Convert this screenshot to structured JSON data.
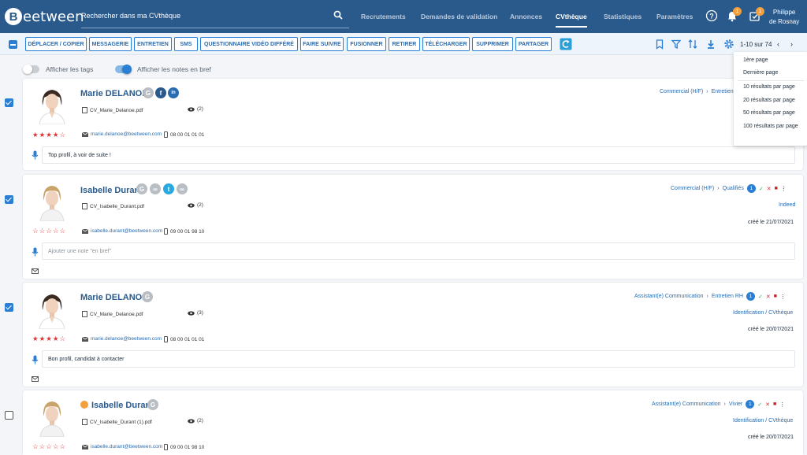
{
  "app": {
    "logo_letter": "B",
    "logo_text": "eetween",
    "brand_color": "#2a5a8c",
    "accent_color": "#2a7ed3"
  },
  "search": {
    "placeholder": "Rechercher dans ma CVthèque"
  },
  "nav": {
    "items": [
      "Recrutements",
      "Demandes de validation",
      "Annonces",
      "CVthèque",
      "Statistiques",
      "Paramètres"
    ],
    "active": "CVthèque"
  },
  "header": {
    "notif_count": "1",
    "task_count": "1",
    "user_line1": "Philippe",
    "user_line2": "de Rosnay"
  },
  "toolbar": {
    "buttons": [
      "DÉPLACER / COPIER",
      "MESSAGERIE",
      "ENTRETIEN",
      "SMS",
      "QUESTIONNAIRE VIDÉO DIFFÉRÉ",
      "FAIRE SUIVRE",
      "FUSIONNER",
      "RETIRER",
      "TÉLÉCHARGER",
      "SUPPRIMER",
      "PARTAGER"
    ],
    "pagination": "1-10 sur 74"
  },
  "dropdown": {
    "items": [
      "1ère page",
      "Dernière page",
      "10 résultats par page",
      "20 résultats par page",
      "50 résultats par page",
      "100 résultats par page"
    ]
  },
  "toggles": {
    "tags_label": "Afficher les tags",
    "tags_on": false,
    "notes_label": "Afficher les notes en bref",
    "notes_on": true
  },
  "candidates": [
    {
      "name": "Marie DELANOE",
      "cv_file": "CV_Marie_Delanoe.pdf",
      "views": "(2)",
      "email": "marie.delanoe@beetween.com",
      "phone": "08 00 01 01 01",
      "rating": 4,
      "note": "Top profil, à voir de suite !",
      "pipeline_job": "Commercial (H/F)",
      "pipeline_stage": "Entretien",
      "checked": true
    },
    {
      "name": "Isabelle Durant",
      "cv_file": "CV_Isabelle_Durant.pdf",
      "views": "(2)",
      "email": "isabelle.durant@beetween.com",
      "phone": "09 00 01 98 10",
      "rating": 0,
      "note_placeholder": "Ajouter une note \"en bref\"",
      "pipeline_job": "Commercial (H/F)",
      "pipeline_stage": "Qualifiés",
      "stage_count": "1",
      "source": "Indeed",
      "created": "créé le 21/07/2021",
      "checked": true
    },
    {
      "name": "Marie DELANOE",
      "cv_file": "CV_Marie_Delanoe.pdf",
      "views": "(3)",
      "email": "marie.delanoe@beetween.com",
      "phone": "08 00 01 01 01",
      "rating": 4,
      "note": "Bon profil, candidat à contacter",
      "pipeline_job": "Assistant(e) Communication",
      "pipeline_stage": "Entretien RH",
      "stage_count": "1",
      "source": "Identification / CVthèque",
      "created": "créé le 20/07/2021",
      "checked": true
    },
    {
      "name": "Isabelle Durant",
      "cv_file": "CV_Isabelle_Durant (1).pdf",
      "views": "(2)",
      "email": "isabelle.durant@beetween.com",
      "phone": "09 00 01 98 10",
      "rating": 0,
      "pipeline_job": "Assistant(e) Communication",
      "pipeline_stage": "Vivier",
      "stage_count": "1",
      "source": "Identification / CVthèque",
      "created": "créé le 20/07/2021",
      "checked": false
    }
  ]
}
